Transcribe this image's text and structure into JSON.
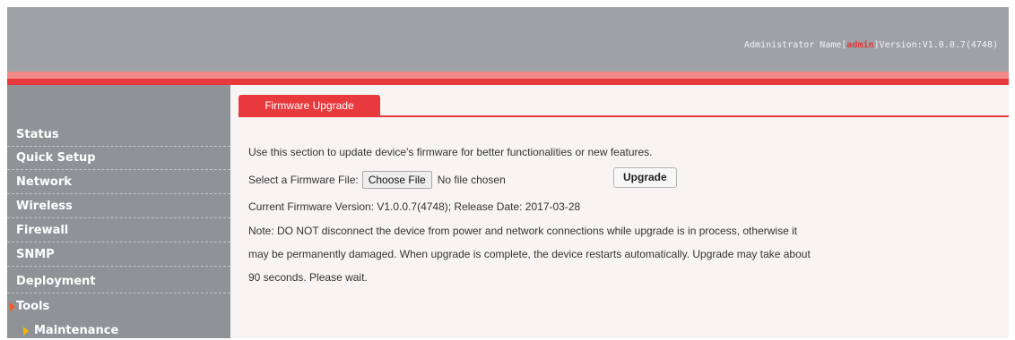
{
  "header": {
    "admin_prefix": "Administrator Name[",
    "admin_user": "admin",
    "admin_suffix": "]",
    "version_label": "Version:V1.0.0.7(4748)"
  },
  "sidebar": {
    "items": [
      {
        "label": "Status"
      },
      {
        "label": "Quick Setup"
      },
      {
        "label": "Network"
      },
      {
        "label": "Wireless"
      },
      {
        "label": "Firewall"
      },
      {
        "label": "SNMP"
      },
      {
        "label": "Deployment"
      },
      {
        "label": "Tools"
      }
    ],
    "sub_items": [
      {
        "label": "Maintenance"
      }
    ],
    "active_item": "Tools",
    "active_sub_item": "Maintenance"
  },
  "main": {
    "tab_label": "Firmware Upgrade",
    "intro": "Use this section to update device's firmware for better functionalities or new features.",
    "select_label": "Select a Firmware File:",
    "choose_file_label": "Choose File",
    "file_status": "No file chosen",
    "upgrade_label": "Upgrade",
    "current_version": "Current Firmware Version: V1.0.0.7(4748); Release Date: 2017-03-28",
    "note_line1": "Note: DO NOT disconnect the device from power and network connections while upgrade is in process, otherwise it",
    "note_line2": "may be permanently damaged. When upgrade is complete, the device restarts automatically. Upgrade may take about",
    "note_line3": "90 seconds. Please wait."
  },
  "colors": {
    "accent_red": "#e8393d",
    "header_gray": "#9ea1a5",
    "sidebar_gray": "#8f9296",
    "content_bg": "#f8f4f4"
  }
}
